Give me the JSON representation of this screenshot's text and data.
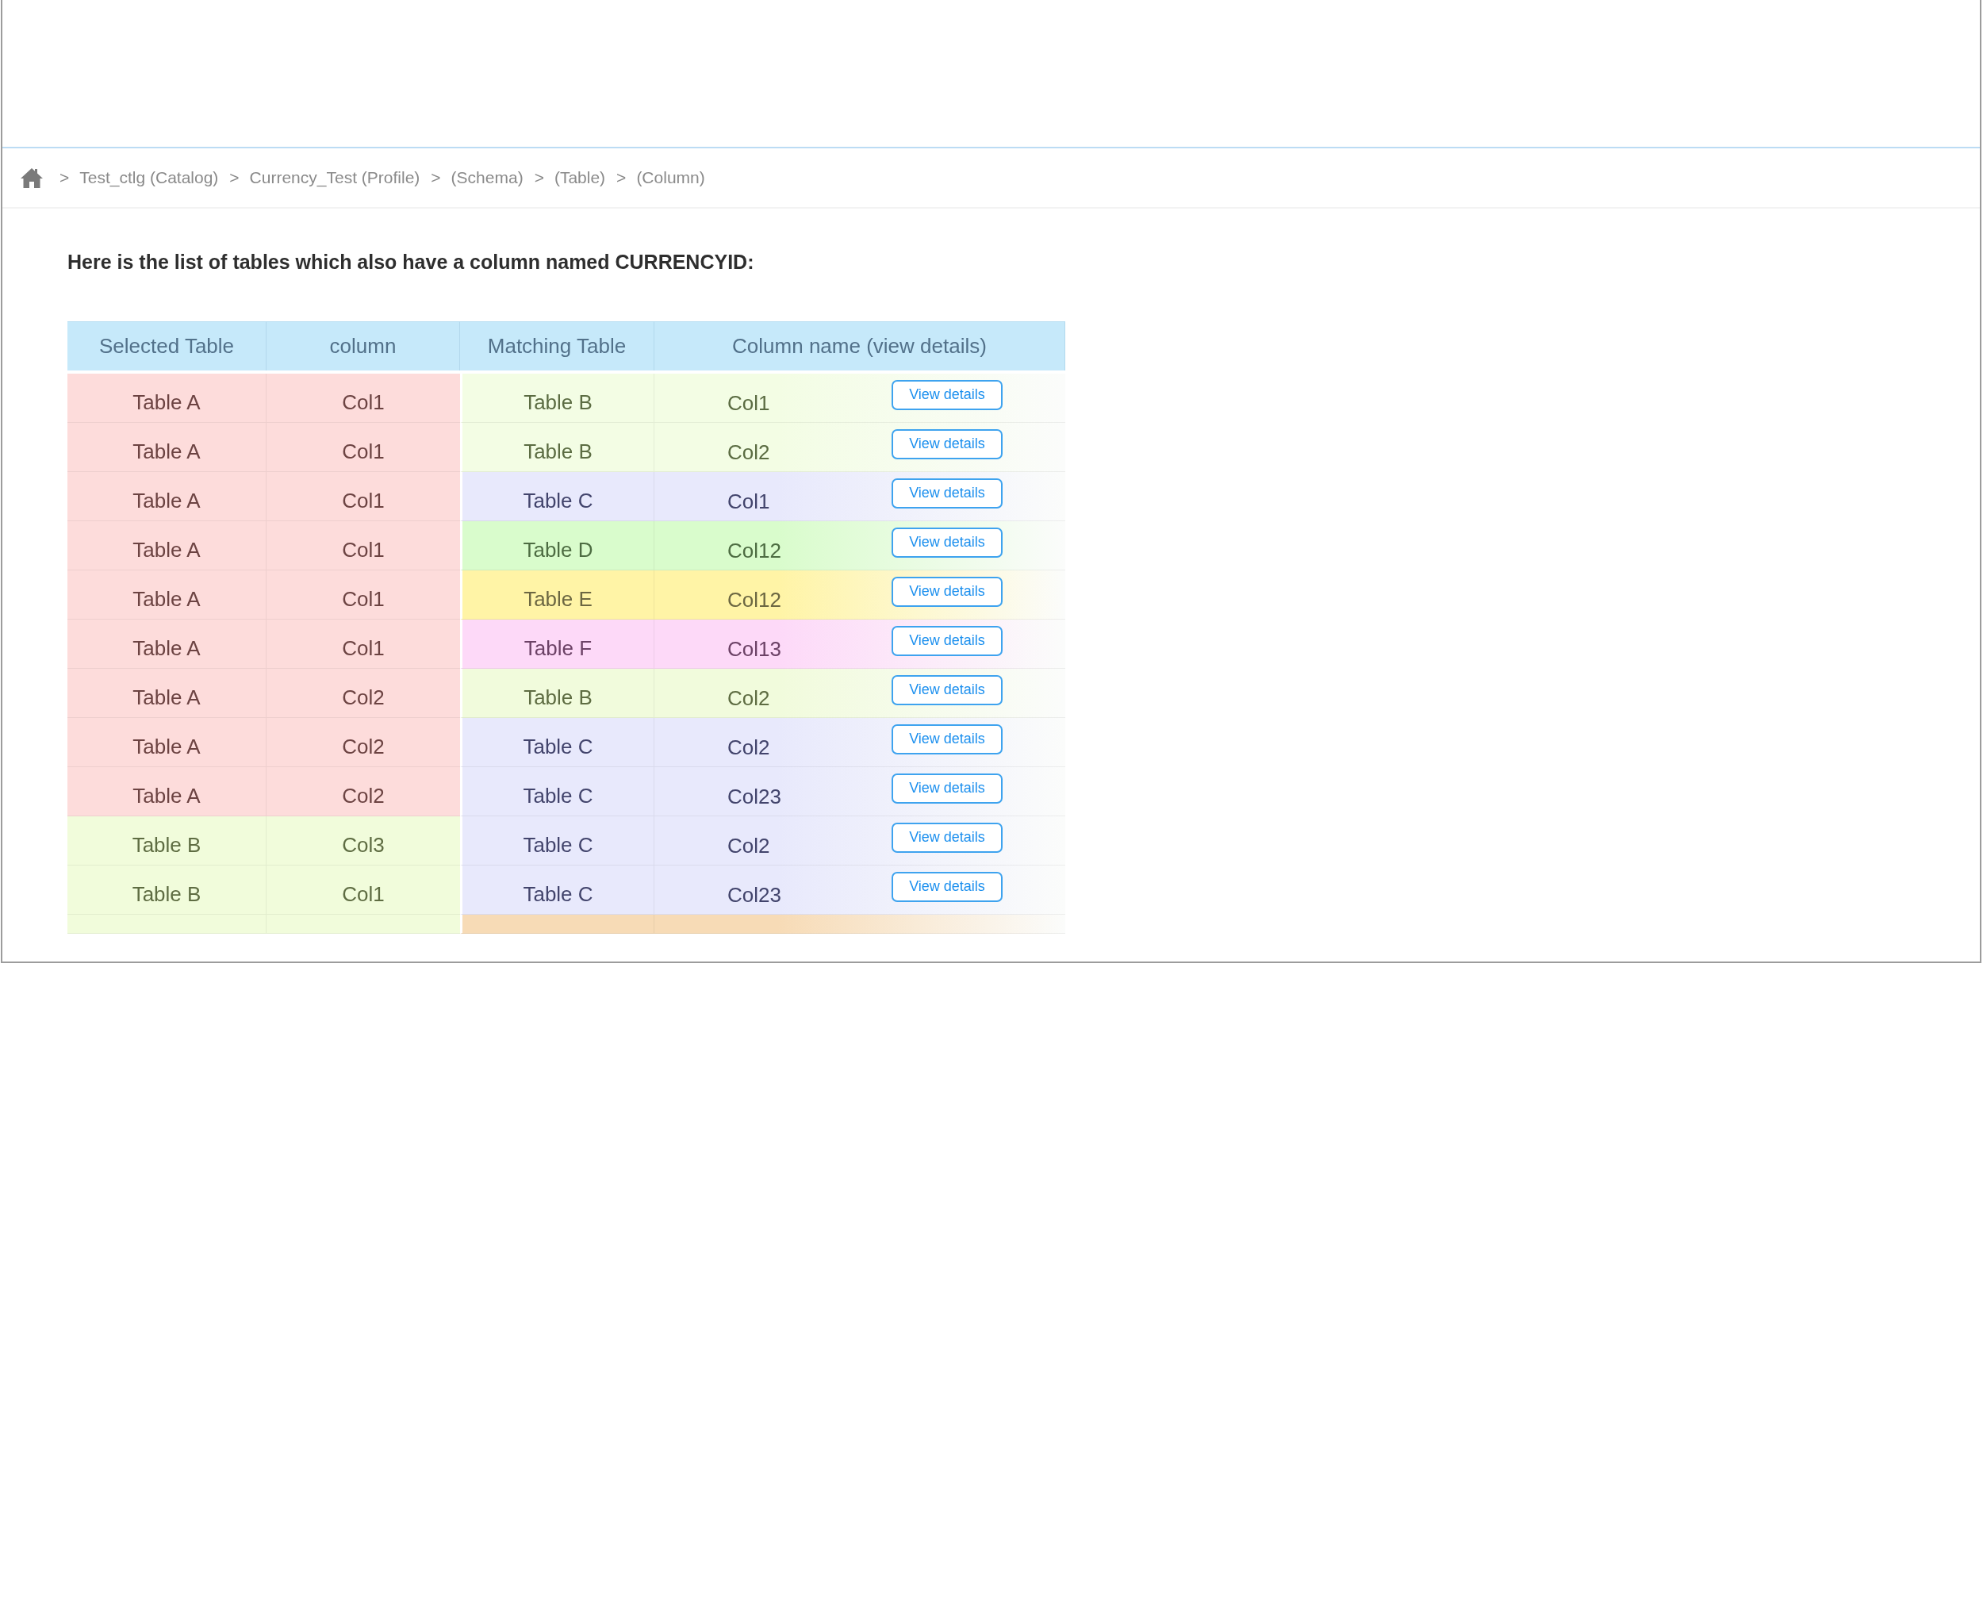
{
  "breadcrumb": {
    "items": [
      {
        "separator": ">",
        "label": "Test_ctlg (Catalog)"
      },
      {
        "separator": ">",
        "label": "Currency_Test (Profile)"
      },
      {
        "separator": ">",
        "label": "(Schema)"
      },
      {
        "separator": ">",
        "label": "(Table)"
      },
      {
        "separator": ">",
        "label": "(Column)"
      }
    ]
  },
  "heading": "Here is the list of tables which also have a column named CURRENCYID:",
  "table": {
    "columns": [
      "Selected Table",
      "column",
      "Matching Table",
      "Column name (view details)"
    ],
    "rows": [
      {
        "kind": "full",
        "source": {
          "table": "Table A",
          "column": "Col1",
          "color": "#fddcdb"
        },
        "match": {
          "table": "Table B",
          "column": "Col1",
          "color": "#f3fde4"
        },
        "action": "View details"
      },
      {
        "kind": "full",
        "source": {
          "table": "Table A",
          "column": "Col1",
          "color": "#fddcdb"
        },
        "match": {
          "table": "Table B",
          "column": "Col2",
          "color": "#f3fde4"
        },
        "action": "View details"
      },
      {
        "kind": "full",
        "source": {
          "table": "Table A",
          "column": "Col1",
          "color": "#fddcdb"
        },
        "match": {
          "table": "Table C",
          "column": "Col1",
          "color": "#e8e9fc"
        },
        "action": "View details"
      },
      {
        "kind": "full",
        "source": {
          "table": "Table A",
          "column": "Col1",
          "color": "#fddcdb"
        },
        "match": {
          "table": "Table D",
          "column": "Col12",
          "color": "#d9fccc"
        },
        "action": "View details"
      },
      {
        "kind": "full",
        "source": {
          "table": "Table A",
          "column": "Col1",
          "color": "#fddcdb"
        },
        "match": {
          "table": "Table E",
          "column": "Col12",
          "color": "#fff4a6"
        },
        "action": "View details"
      },
      {
        "kind": "full",
        "source": {
          "table": "Table A",
          "column": "Col1",
          "color": "#fddcdb"
        },
        "match": {
          "table": "Table F",
          "column": "Col13",
          "color": "#fdd9f8"
        },
        "action": "View details"
      },
      {
        "kind": "full",
        "source": {
          "table": "Table A",
          "column": "Col2",
          "color": "#fddcdb"
        },
        "match": {
          "table": "Table B",
          "column": "Col2",
          "color": "#f1fbdc"
        },
        "action": "View details"
      },
      {
        "kind": "full",
        "source": {
          "table": "Table A",
          "column": "Col2",
          "color": "#fddcdb"
        },
        "match": {
          "table": "Table C",
          "column": "Col2",
          "color": "#e8e9fc"
        },
        "action": "View details"
      },
      {
        "kind": "full",
        "source": {
          "table": "Table A",
          "column": "Col2",
          "color": "#fddcdb"
        },
        "match": {
          "table": "Table C",
          "column": "Col23",
          "color": "#e8e9fc"
        },
        "action": "View details"
      },
      {
        "kind": "full",
        "source": {
          "table": "Table B",
          "column": "Col3",
          "color": "#f1fcdb"
        },
        "match": {
          "table": "Table C",
          "column": "Col2",
          "color": "#e8e9fc"
        },
        "action": "View details"
      },
      {
        "kind": "full",
        "source": {
          "table": "Table B",
          "column": "Col1",
          "color": "#f1fcdb"
        },
        "match": {
          "table": "Table C",
          "column": "Col23",
          "color": "#e8e9fc"
        },
        "action": "View details"
      },
      {
        "kind": "cut",
        "source": {
          "color": "#f1fcdb"
        },
        "match": {
          "color": "#f7dbb6"
        }
      }
    ]
  }
}
